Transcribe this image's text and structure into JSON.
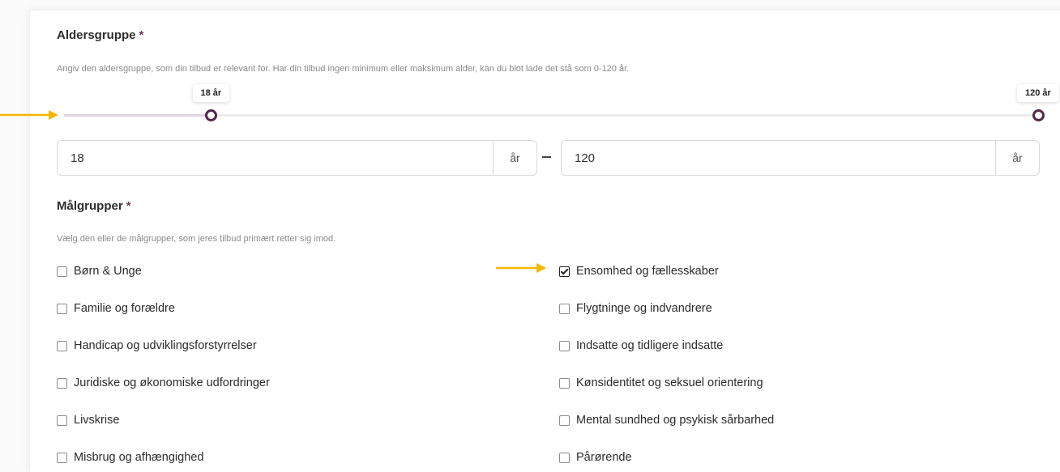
{
  "age_section": {
    "title": "Aldersgruppe",
    "required_mark": "*",
    "hint": "Angiv den aldersgruppe, som din tilbud er relevant for. Har din tilbud ingen minimum eller maksimum alder, kan du blot lade det stå som 0-120 år.",
    "slider": {
      "range_min": 0,
      "range_max": 120,
      "min_value": 18,
      "max_value": 120,
      "min_bubble": "18 år",
      "max_bubble": "120 år"
    },
    "min_input_value": "18",
    "max_input_value": "120",
    "unit": "år"
  },
  "target_section": {
    "title": "Målgrupper",
    "required_mark": "*",
    "hint": "Vælg den eller de målgrupper, som jeres tilbud primært retter sig imod.",
    "left_options": [
      {
        "label": "Børn & Unge",
        "checked": false
      },
      {
        "label": "Familie og forældre",
        "checked": false
      },
      {
        "label": "Handicap og udviklingsforstyrrelser",
        "checked": false
      },
      {
        "label": "Juridiske og økonomiske udfordringer",
        "checked": false
      },
      {
        "label": "Livskrise",
        "checked": false
      },
      {
        "label": "Misbrug og afhængighed",
        "checked": false
      }
    ],
    "right_options": [
      {
        "label": "Ensomhed og fællesskaber",
        "checked": true
      },
      {
        "label": "Flygtninge og indvandrere",
        "checked": false
      },
      {
        "label": "Indsatte og tidligere indsatte",
        "checked": false
      },
      {
        "label": "Kønsidentitet og seksuel orientering",
        "checked": false
      },
      {
        "label": "Mental sundhed og psykisk sårbarhed",
        "checked": false
      },
      {
        "label": "Pårørende",
        "checked": false
      }
    ]
  },
  "colors": {
    "accent": "#55284a",
    "annotation_arrow": "#f5b700"
  }
}
